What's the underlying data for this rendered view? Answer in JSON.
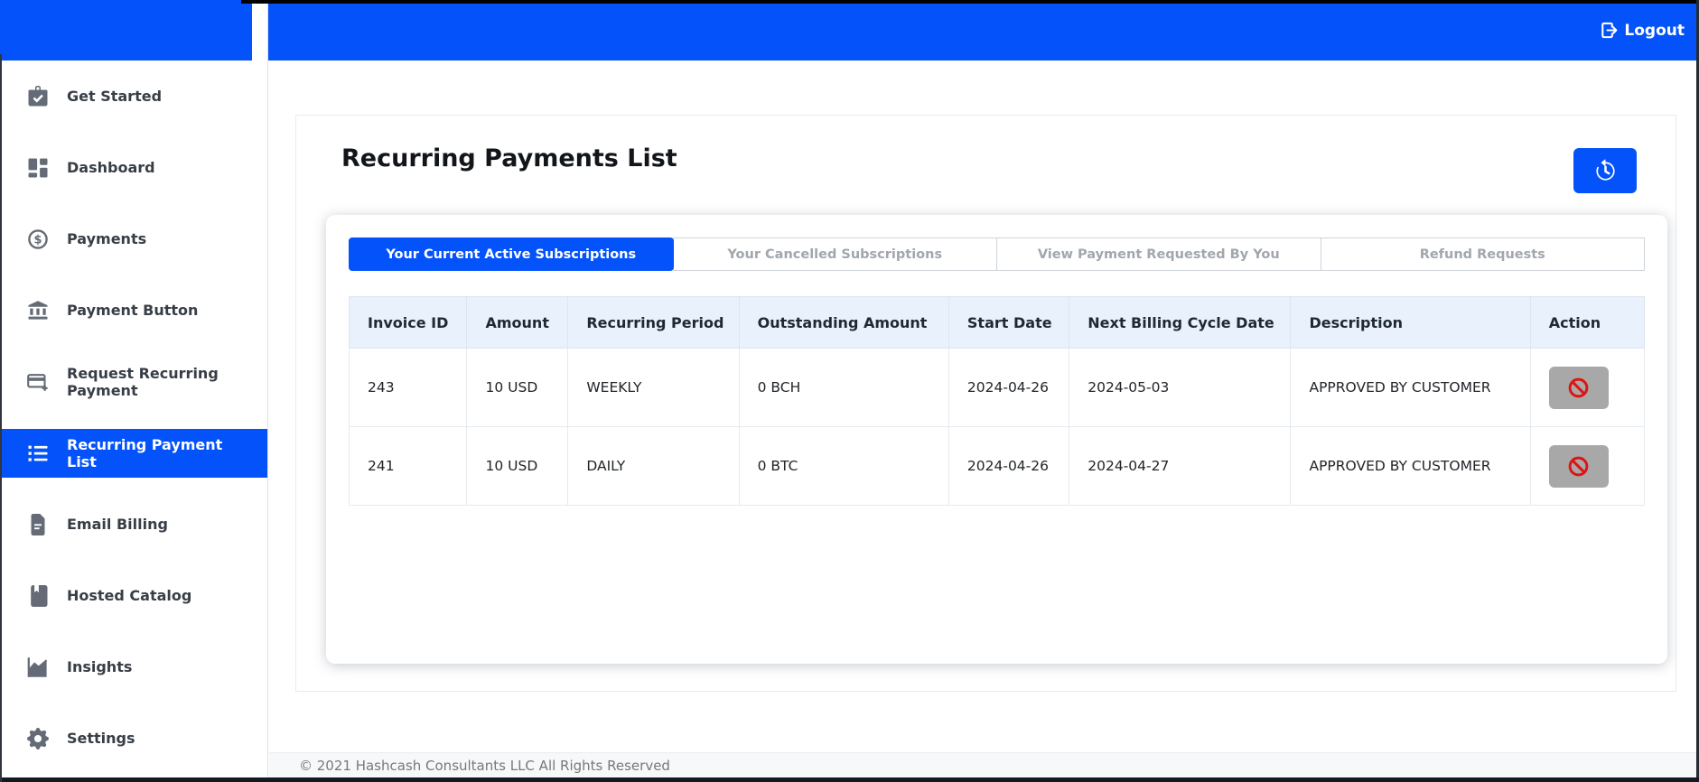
{
  "topbar": {
    "logout_label": "Logout"
  },
  "sidebar": {
    "items": [
      {
        "label": "Get Started",
        "icon": "briefcase-check-icon",
        "active": false
      },
      {
        "label": "Dashboard",
        "icon": "dashboard-grid-icon",
        "active": false
      },
      {
        "label": "Payments",
        "icon": "dollar-circle-icon",
        "active": false
      },
      {
        "label": "Payment Button",
        "icon": "bank-icon",
        "active": false
      },
      {
        "label": "Request Recurring Payment",
        "icon": "card-plus-icon",
        "active": false
      },
      {
        "label": "Recurring Payment List",
        "icon": "list-icon",
        "active": true
      },
      {
        "label": "Email Billing",
        "icon": "file-text-icon",
        "active": false
      },
      {
        "label": "Hosted Catalog",
        "icon": "book-icon",
        "active": false
      },
      {
        "label": "Insights",
        "icon": "chart-line-icon",
        "active": false
      },
      {
        "label": "Settings",
        "icon": "gear-icon",
        "active": false
      }
    ]
  },
  "page": {
    "title": "Recurring Payments List"
  },
  "tabs": [
    {
      "label": "Your Current Active Subscriptions",
      "active": true
    },
    {
      "label": "Your Cancelled Subscriptions",
      "active": false
    },
    {
      "label": "View Payment Requested By You",
      "active": false
    },
    {
      "label": "Refund Requests",
      "active": false
    }
  ],
  "table": {
    "columns": [
      "Invoice ID",
      "Amount",
      "Recurring Period",
      "Outstanding Amount",
      "Start Date",
      "Next Billing Cycle Date",
      "Description",
      "Action"
    ],
    "rows": [
      {
        "invoice_id": "243",
        "amount": "10 USD",
        "recurring_period": "WEEKLY",
        "outstanding_amount": "0 BCH",
        "start_date": "2024-04-26",
        "next_billing_cycle_date": "2024-05-03",
        "description": "APPROVED BY CUSTOMER"
      },
      {
        "invoice_id": "241",
        "amount": "10 USD",
        "recurring_period": "DAILY",
        "outstanding_amount": "0 BTC",
        "start_date": "2024-04-26",
        "next_billing_cycle_date": "2024-04-27",
        "description": "APPROVED BY CUSTOMER"
      }
    ]
  },
  "footer": {
    "copyright": "© 2021 Hashcash Consultants LLC All Rights Reserved"
  },
  "colors": {
    "primary": "#0452fa",
    "ban_red": "#e01212",
    "action_gray": "#a8a8a8",
    "header_bg": "#e9f1fc"
  }
}
